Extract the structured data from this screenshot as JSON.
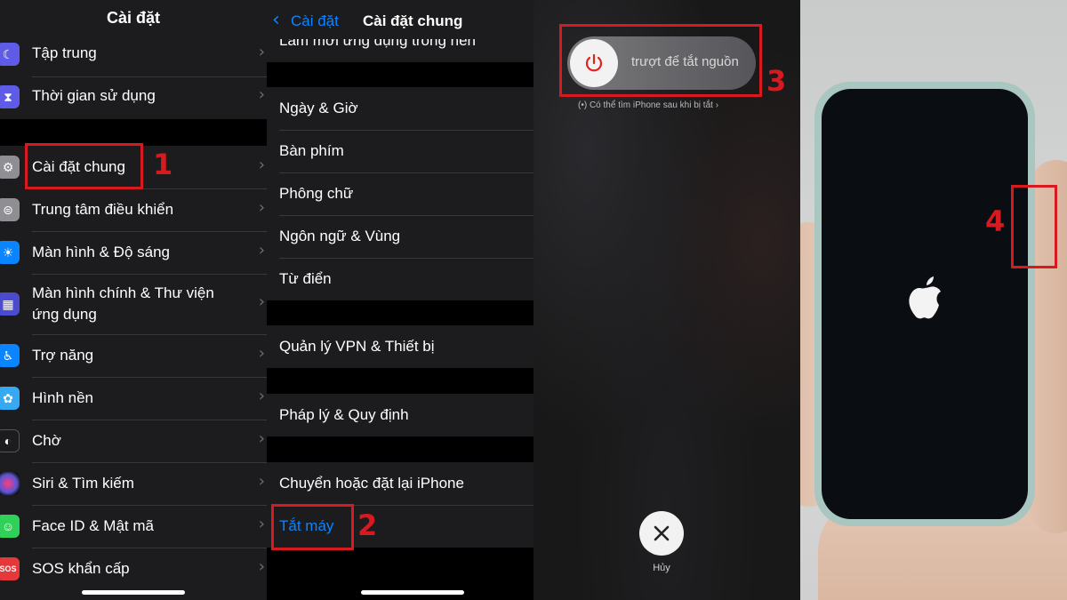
{
  "panel1": {
    "header_title": "Cài đặt",
    "rows": [
      {
        "label": "Tập trung",
        "icon": "moon-icon",
        "color": "#5e5ce6"
      },
      {
        "label": "Thời gian sử dụng",
        "icon": "hourglass-icon",
        "color": "#5e5ce6"
      },
      {
        "label": "Cài đặt chung",
        "icon": "gear-icon",
        "color": "#8e8e93"
      },
      {
        "label": "Trung tâm điều khiển",
        "icon": "toggles-icon",
        "color": "#8e8e93"
      },
      {
        "label": "Màn hình & Độ sáng",
        "icon": "sun-icon",
        "color": "#0a84ff"
      },
      {
        "label_line1": "Màn hình chính & Thư viện",
        "label_line2": "ứng dụng",
        "icon": "app-grid-icon",
        "color": "#4b4bd0"
      },
      {
        "label": "Trợ năng",
        "icon": "accessibility-icon",
        "color": "#0a84ff"
      },
      {
        "label": "Hình nền",
        "icon": "flower-icon",
        "color": "#35aaf2"
      },
      {
        "label": "Chờ",
        "icon": "standby-icon",
        "color": "#1c1c1e"
      },
      {
        "label": "Siri & Tìm kiếm",
        "icon": "siri-icon",
        "color": "#222"
      },
      {
        "label": "Face ID & Mật mã",
        "icon": "face-id-icon",
        "color": "#30d158"
      },
      {
        "label": "SOS khẩn cấp",
        "icon": "sos-icon",
        "color": "#e5383b"
      }
    ],
    "sos_text": "SOS",
    "step": "1"
  },
  "panel2": {
    "back_label": "Cài đặt",
    "title": "Cài đặt chung",
    "partial_row": "Làm mới ứng dụng trong nền",
    "rows": {
      "date_time": "Ngày & Giờ",
      "keyboard": "Bàn phím",
      "fonts": "Phông chữ",
      "language_region": "Ngôn ngữ & Vùng",
      "dictionary": "Từ điển",
      "vpn": "Quản lý VPN & Thiết bị",
      "legal": "Pháp lý & Quy định",
      "transfer_reset": "Chuyển hoặc đặt lại iPhone",
      "shutdown": "Tắt máy"
    },
    "step": "2"
  },
  "panel3": {
    "slider_text": "trượt để tắt nguồn",
    "find_note": "Có thể tìm iPhone sau khi bị tắt",
    "cancel_label": "Hủy",
    "step": "3"
  },
  "panel4": {
    "step": "4"
  },
  "colors": {
    "accent_red": "#d71920",
    "ios_blue": "#0a84ff"
  }
}
